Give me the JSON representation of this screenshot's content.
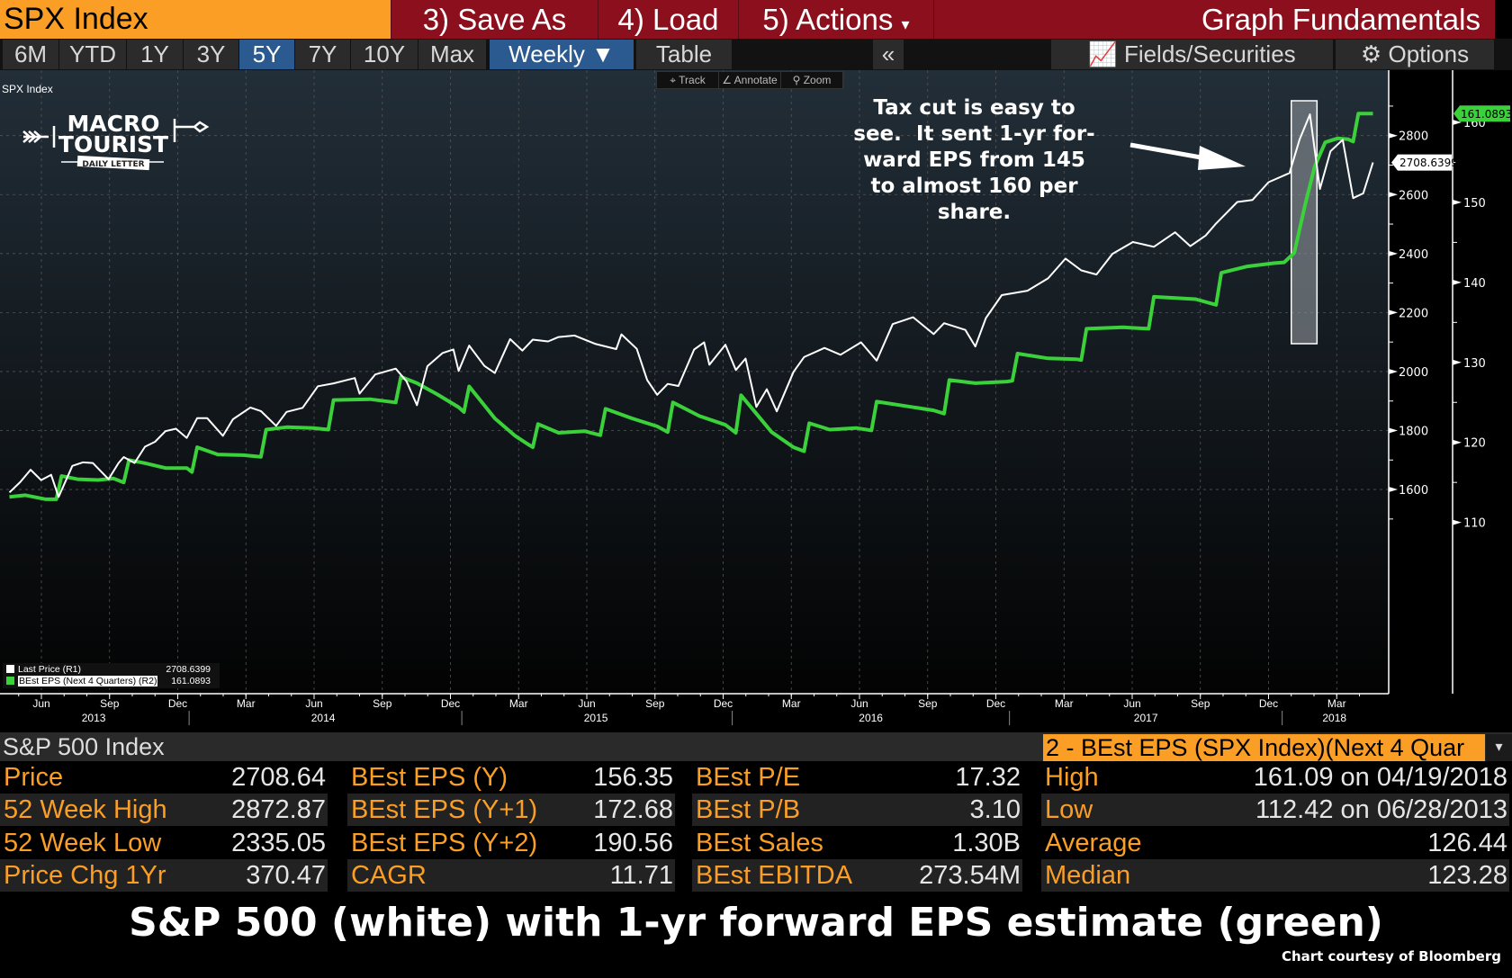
{
  "topbar": {
    "security": "SPX Index",
    "save_as": "3) Save As",
    "load": "4) Load",
    "actions": "5) Actions",
    "actions_arrow": "▾",
    "title": "Graph Fundamentals"
  },
  "periods": [
    "6M",
    "YTD",
    "1Y",
    "3Y",
    "5Y",
    "7Y",
    "10Y",
    "Max"
  ],
  "active_period": "5Y",
  "frequency": "Weekly ▼",
  "table_btn": "Table",
  "collapse": "«",
  "fields": "Fields/Securities",
  "options": "Options",
  "chart_tools": {
    "track": "⌖ Track",
    "annotate": "∠ Annotate",
    "zoom": "⚲ Zoom"
  },
  "logo": {
    "line1": "MACRO",
    "line2": "TOURIST",
    "line3": "DAILY LETTER"
  },
  "annotation": [
    "Tax cut is easy to",
    "see.  It sent 1-yr for-",
    "ward EPS from 145",
    "to almost 160 per",
    "share."
  ],
  "legend": [
    {
      "label": "Last Price  (R1)",
      "value": "2708.6399",
      "color": "#ffffff"
    },
    {
      "label": "BEst EPS (Next 4 Quarters) (R2)",
      "value": "161.0893",
      "color": "#3bd13b"
    }
  ],
  "chart_data": {
    "type": "line",
    "title": "SPX Index",
    "left_axis": {
      "ticks": [
        1600,
        1800,
        2000,
        2200,
        2400,
        2600,
        2800
      ],
      "range": [
        1480,
        2940
      ],
      "last_label": "2708.6399"
    },
    "right_axis": {
      "ticks": [
        110,
        120,
        130,
        140,
        150,
        160
      ],
      "range": [
        108.5,
        161.5
      ],
      "last_label": "161.0893"
    },
    "x_month_labels": [
      [
        "2013-06",
        "Jun"
      ],
      [
        "2013-09",
        "Sep"
      ],
      [
        "2013-12",
        "Dec"
      ],
      [
        "2014-03",
        "Mar"
      ],
      [
        "2014-06",
        "Jun"
      ],
      [
        "2014-09",
        "Sep"
      ],
      [
        "2014-12",
        "Dec"
      ],
      [
        "2015-03",
        "Mar"
      ],
      [
        "2015-06",
        "Jun"
      ],
      [
        "2015-09",
        "Sep"
      ],
      [
        "2015-12",
        "Dec"
      ],
      [
        "2016-03",
        "Mar"
      ],
      [
        "2016-06",
        "Jun"
      ],
      [
        "2016-09",
        "Sep"
      ],
      [
        "2016-12",
        "Dec"
      ],
      [
        "2017-03",
        "Mar"
      ],
      [
        "2017-06",
        "Jun"
      ],
      [
        "2017-09",
        "Sep"
      ],
      [
        "2017-12",
        "Dec"
      ],
      [
        "2018-03",
        "Mar"
      ]
    ],
    "x_year_labels": [
      "2013",
      "2014",
      "2015",
      "2016",
      "2017",
      "2018"
    ],
    "highlight": {
      "from": "2018-01-01",
      "to": "2018-02-05"
    },
    "series": [
      {
        "name": "Last Price",
        "axis": "left",
        "color": "#ffffff",
        "points": [
          [
            "2013-04-19",
            1590
          ],
          [
            "2013-05-03",
            1625
          ],
          [
            "2013-05-17",
            1667
          ],
          [
            "2013-05-31",
            1632
          ],
          [
            "2013-06-14",
            1650
          ],
          [
            "2013-06-24",
            1575
          ],
          [
            "2013-07-12",
            1680
          ],
          [
            "2013-07-26",
            1692
          ],
          [
            "2013-08-09",
            1690
          ],
          [
            "2013-08-30",
            1635
          ],
          [
            "2013-09-13",
            1690
          ],
          [
            "2013-09-20",
            1710
          ],
          [
            "2013-10-04",
            1690
          ],
          [
            "2013-10-18",
            1745
          ],
          [
            "2013-11-01",
            1762
          ],
          [
            "2013-11-15",
            1798
          ],
          [
            "2013-11-29",
            1806
          ],
          [
            "2013-12-13",
            1775
          ],
          [
            "2013-12-27",
            1842
          ],
          [
            "2014-01-10",
            1842
          ],
          [
            "2014-01-31",
            1782
          ],
          [
            "2014-02-14",
            1838
          ],
          [
            "2014-03-07",
            1878
          ],
          [
            "2014-03-21",
            1866
          ],
          [
            "2014-04-11",
            1816
          ],
          [
            "2014-04-25",
            1863
          ],
          [
            "2014-05-16",
            1877
          ],
          [
            "2014-06-06",
            1950
          ],
          [
            "2014-06-27",
            1960
          ],
          [
            "2014-07-25",
            1978
          ],
          [
            "2014-08-01",
            1925
          ],
          [
            "2014-08-22",
            1990
          ],
          [
            "2014-09-19",
            2010
          ],
          [
            "2014-10-03",
            1967
          ],
          [
            "2014-10-17",
            1886
          ],
          [
            "2014-10-31",
            2018
          ],
          [
            "2014-11-21",
            2063
          ],
          [
            "2014-12-05",
            2075
          ],
          [
            "2014-12-12",
            2002
          ],
          [
            "2014-12-26",
            2088
          ],
          [
            "2015-01-16",
            2019
          ],
          [
            "2015-01-30",
            1995
          ],
          [
            "2015-02-20",
            2110
          ],
          [
            "2015-03-06",
            2071
          ],
          [
            "2015-03-20",
            2108
          ],
          [
            "2015-04-10",
            2102
          ],
          [
            "2015-04-24",
            2117
          ],
          [
            "2015-05-15",
            2122
          ],
          [
            "2015-06-12",
            2094
          ],
          [
            "2015-07-10",
            2076
          ],
          [
            "2015-07-17",
            2126
          ],
          [
            "2015-08-07",
            2077
          ],
          [
            "2015-08-21",
            1971
          ],
          [
            "2015-09-04",
            1921
          ],
          [
            "2015-09-18",
            1958
          ],
          [
            "2015-10-02",
            1951
          ],
          [
            "2015-10-23",
            2075
          ],
          [
            "2015-11-06",
            2099
          ],
          [
            "2015-11-13",
            2023
          ],
          [
            "2015-12-04",
            2091
          ],
          [
            "2015-12-18",
            2005
          ],
          [
            "2015-12-31",
            2044
          ],
          [
            "2016-01-15",
            1880
          ],
          [
            "2016-01-29",
            1940
          ],
          [
            "2016-02-12",
            1865
          ],
          [
            "2016-03-04",
            1999
          ],
          [
            "2016-03-18",
            2049
          ],
          [
            "2016-04-15",
            2080
          ],
          [
            "2016-05-06",
            2057
          ],
          [
            "2016-06-03",
            2099
          ],
          [
            "2016-06-24",
            2037
          ],
          [
            "2016-07-15",
            2161
          ],
          [
            "2016-08-12",
            2184
          ],
          [
            "2016-09-09",
            2127
          ],
          [
            "2016-09-23",
            2164
          ],
          [
            "2016-10-21",
            2141
          ],
          [
            "2016-11-04",
            2085
          ],
          [
            "2016-11-18",
            2181
          ],
          [
            "2016-12-09",
            2259
          ],
          [
            "2017-01-13",
            2274
          ],
          [
            "2017-02-10",
            2316
          ],
          [
            "2017-03-03",
            2383
          ],
          [
            "2017-03-24",
            2343
          ],
          [
            "2017-04-14",
            2329
          ],
          [
            "2017-05-05",
            2399
          ],
          [
            "2017-06-02",
            2439
          ],
          [
            "2017-06-30",
            2423
          ],
          [
            "2017-07-28",
            2472
          ],
          [
            "2017-08-18",
            2425
          ],
          [
            "2017-09-08",
            2461
          ],
          [
            "2017-09-22",
            2502
          ],
          [
            "2017-10-20",
            2575
          ],
          [
            "2017-11-10",
            2582
          ],
          [
            "2017-12-01",
            2642
          ],
          [
            "2017-12-29",
            2673
          ],
          [
            "2018-01-12",
            2786
          ],
          [
            "2018-01-26",
            2872
          ],
          [
            "2018-02-09",
            2619
          ],
          [
            "2018-02-23",
            2747
          ],
          [
            "2018-03-09",
            2786
          ],
          [
            "2018-03-23",
            2588
          ],
          [
            "2018-04-06",
            2604
          ],
          [
            "2018-04-19",
            2708.64
          ]
        ]
      },
      {
        "name": "BEst EPS (Next 4 Quarters)",
        "axis": "right",
        "color": "#3bd13b",
        "points": [
          [
            "2013-04-19",
            113.2
          ],
          [
            "2013-05-10",
            113.4
          ],
          [
            "2013-06-07",
            112.9
          ],
          [
            "2013-06-21",
            112.9
          ],
          [
            "2013-06-28",
            115.8
          ],
          [
            "2013-07-19",
            115.4
          ],
          [
            "2013-08-16",
            115.3
          ],
          [
            "2013-09-06",
            115.5
          ],
          [
            "2013-09-20",
            115.0
          ],
          [
            "2013-09-27",
            117.8
          ],
          [
            "2013-10-18",
            117.4
          ],
          [
            "2013-11-15",
            116.8
          ],
          [
            "2013-12-13",
            116.8
          ],
          [
            "2013-12-20",
            116.3
          ],
          [
            "2013-12-27",
            119.4
          ],
          [
            "2014-01-24",
            118.5
          ],
          [
            "2014-02-28",
            118.4
          ],
          [
            "2014-03-21",
            118.2
          ],
          [
            "2014-03-28",
            121.6
          ],
          [
            "2014-04-25",
            121.9
          ],
          [
            "2014-05-30",
            121.8
          ],
          [
            "2014-06-20",
            121.6
          ],
          [
            "2014-06-27",
            125.3
          ],
          [
            "2014-08-15",
            125.4
          ],
          [
            "2014-09-19",
            125.0
          ],
          [
            "2014-09-26",
            128.2
          ],
          [
            "2014-10-17",
            127.4
          ],
          [
            "2014-11-14",
            126.0
          ],
          [
            "2014-12-12",
            124.4
          ],
          [
            "2014-12-19",
            123.8
          ],
          [
            "2014-12-26",
            127.0
          ],
          [
            "2015-01-30",
            123.0
          ],
          [
            "2015-02-27",
            120.8
          ],
          [
            "2015-03-13",
            119.8
          ],
          [
            "2015-03-20",
            119.4
          ],
          [
            "2015-03-27",
            122.3
          ],
          [
            "2015-04-24",
            121.2
          ],
          [
            "2015-05-29",
            121.4
          ],
          [
            "2015-06-19",
            120.9
          ],
          [
            "2015-06-26",
            124.2
          ],
          [
            "2015-07-31",
            123.0
          ],
          [
            "2015-09-04",
            122.0
          ],
          [
            "2015-09-18",
            121.3
          ],
          [
            "2015-09-25",
            125.0
          ],
          [
            "2015-10-30",
            123.3
          ],
          [
            "2015-12-04",
            122.2
          ],
          [
            "2015-12-18",
            121.2
          ],
          [
            "2015-12-25",
            125.9
          ],
          [
            "2016-02-05",
            121.3
          ],
          [
            "2016-03-04",
            119.4
          ],
          [
            "2016-03-18",
            118.9
          ],
          [
            "2016-03-25",
            122.4
          ],
          [
            "2016-04-22",
            121.6
          ],
          [
            "2016-05-27",
            121.8
          ],
          [
            "2016-06-17",
            121.5
          ],
          [
            "2016-06-24",
            125.1
          ],
          [
            "2016-08-05",
            124.5
          ],
          [
            "2016-09-09",
            124.0
          ],
          [
            "2016-09-23",
            123.6
          ],
          [
            "2016-09-30",
            127.8
          ],
          [
            "2016-11-04",
            127.4
          ],
          [
            "2016-12-16",
            127.6
          ],
          [
            "2016-12-23",
            127.7
          ],
          [
            "2016-12-30",
            131.1
          ],
          [
            "2017-02-10",
            130.5
          ],
          [
            "2017-03-17",
            130.4
          ],
          [
            "2017-03-24",
            130.3
          ],
          [
            "2017-03-31",
            134.2
          ],
          [
            "2017-05-19",
            134.4
          ],
          [
            "2017-06-23",
            134.2
          ],
          [
            "2017-06-30",
            138.2
          ],
          [
            "2017-08-25",
            137.9
          ],
          [
            "2017-09-22",
            137.2
          ],
          [
            "2017-09-29",
            141.2
          ],
          [
            "2017-11-03",
            142.0
          ],
          [
            "2017-12-08",
            142.4
          ],
          [
            "2017-12-22",
            142.5
          ],
          [
            "2018-01-05",
            143.7
          ],
          [
            "2018-01-19",
            149.5
          ],
          [
            "2018-02-02",
            154.5
          ],
          [
            "2018-02-16",
            157.5
          ],
          [
            "2018-03-02",
            158.0
          ],
          [
            "2018-03-16",
            157.9
          ],
          [
            "2018-03-23",
            157.6
          ],
          [
            "2018-03-30",
            161.09
          ],
          [
            "2018-04-19",
            161.09
          ]
        ]
      }
    ]
  },
  "table": {
    "header": "S&P 500 Index",
    "selector": "2 - BEst EPS (SPX Index)(Next 4 Quar",
    "selector_arrow": "▾",
    "columns": [
      [
        [
          "Price",
          "2708.64"
        ],
        [
          "52 Week High",
          "2872.87"
        ],
        [
          "52 Week Low",
          "2335.05"
        ],
        [
          "Price Chg 1Yr",
          "370.47"
        ]
      ],
      [
        [
          "BEst EPS (Y)",
          "156.35"
        ],
        [
          "BEst EPS (Y+1)",
          "172.68"
        ],
        [
          "BEst EPS (Y+2)",
          "190.56"
        ],
        [
          "CAGR",
          "11.71"
        ]
      ],
      [
        [
          "BEst P/E",
          "17.32"
        ],
        [
          "BEst P/B",
          "3.10"
        ],
        [
          "BEst Sales",
          "1.30B"
        ],
        [
          "BEst EBITDA",
          "273.54M"
        ]
      ],
      [
        [
          "High",
          "161.09 on 04/19/2018"
        ],
        [
          "Low",
          "112.42 on 06/28/2013"
        ],
        [
          "Average",
          "126.44"
        ],
        [
          "Median",
          "123.28"
        ]
      ]
    ]
  },
  "caption": "S&P 500 (white) with 1-yr forward EPS estimate (green)",
  "credit": "Chart courtesy of Bloomberg"
}
